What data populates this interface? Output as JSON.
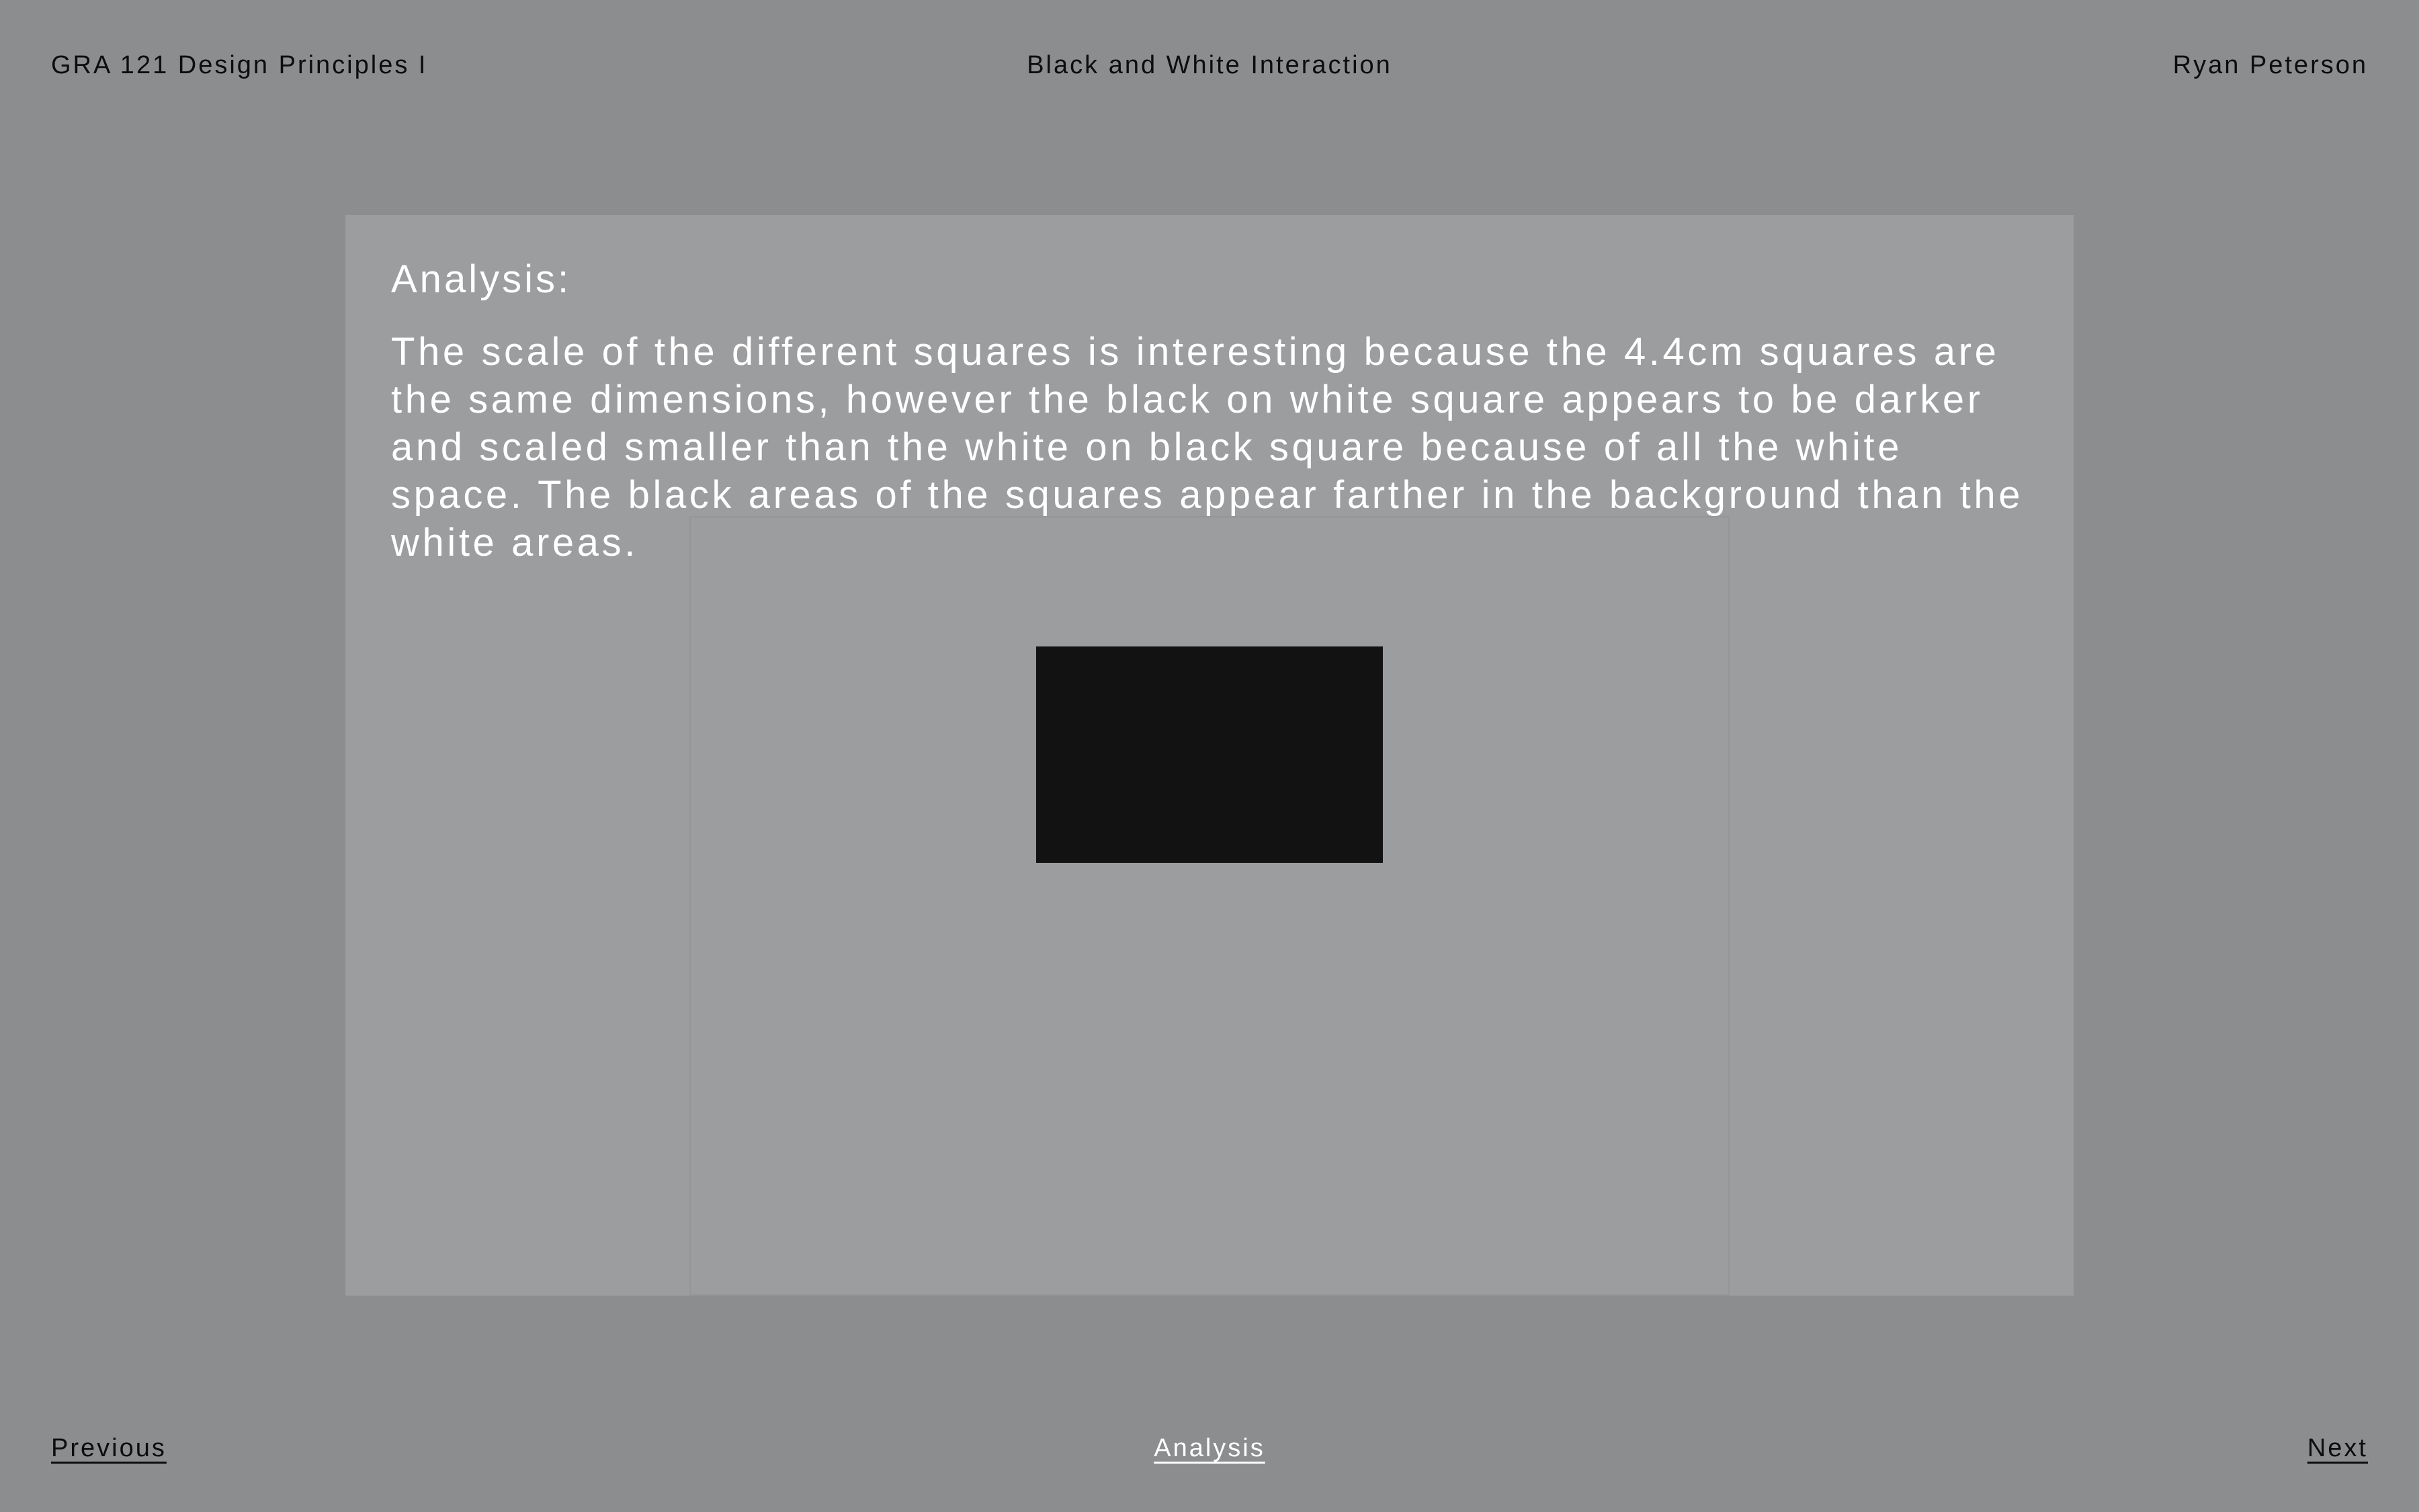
{
  "header": {
    "course": "GRA 121 Design Principles I",
    "project": "Black and White Interaction",
    "author": "Ryan Peterson"
  },
  "slide": {
    "heading": "Analysis:",
    "body": "The scale of the different squares is interesting because the 4.4cm squares are the same dimensions, however the black on white square appears to be darker and scaled smaller than the white on black square because of all the white space. The black areas of the squares appear farther in the background than the white areas."
  },
  "footer": {
    "previous": "Previous",
    "section": "Analysis",
    "next": "Next"
  },
  "colors": {
    "page_background": "#8c8d8f",
    "panel_background": "#9c9d9f",
    "square": "#131213",
    "text_dark": "#0d0d0e",
    "text_light": "#ffffff"
  }
}
